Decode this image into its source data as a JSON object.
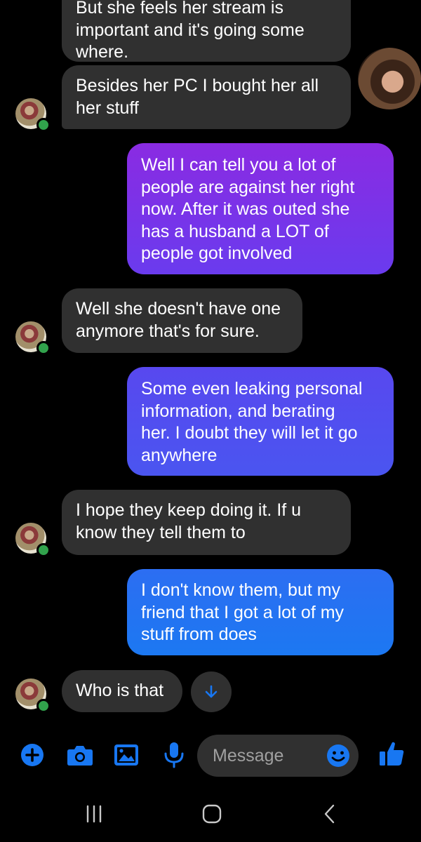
{
  "conversation": {
    "messages": [
      {
        "direction": "incoming",
        "text": "But she feels her stream is\nimportant and it's going some\nwhere."
      },
      {
        "direction": "incoming",
        "text": "Besides her PC I bought her all\nher stuff"
      },
      {
        "direction": "outgoing",
        "text": "Well I can tell you a lot of\npeople are against her right\nnow. After it was outed she\nhas a husband a LOT of\npeople got involved"
      },
      {
        "direction": "incoming",
        "text": "Well she doesn't have one\nanymore that's for sure."
      },
      {
        "direction": "outgoing",
        "text": "Some even leaking personal\ninformation, and berating\nher. I doubt they will let it go\nanywhere"
      },
      {
        "direction": "incoming",
        "text": "I hope they keep doing it.  If u\nknow they tell them to"
      },
      {
        "direction": "outgoing",
        "text": "I don't know them, but my\nfriend that I got a lot of my\nstuff from does"
      },
      {
        "direction": "incoming",
        "text": "Who is that"
      }
    ]
  },
  "composer": {
    "placeholder": "Message",
    "icons": [
      "plus-icon",
      "camera-icon",
      "image-icon",
      "microphone-icon",
      "emoji-icon",
      "thumbs-up-icon"
    ]
  },
  "system_nav": {
    "icons": [
      "recent-apps-icon",
      "home-icon",
      "back-icon"
    ]
  },
  "colors": {
    "accent": "#1877f2",
    "incoming_bubble": "#303030",
    "outgoing_gradient": [
      "#8a2be2",
      "#5b4cf0",
      "#1c78f2"
    ],
    "online": "#31a24c"
  }
}
